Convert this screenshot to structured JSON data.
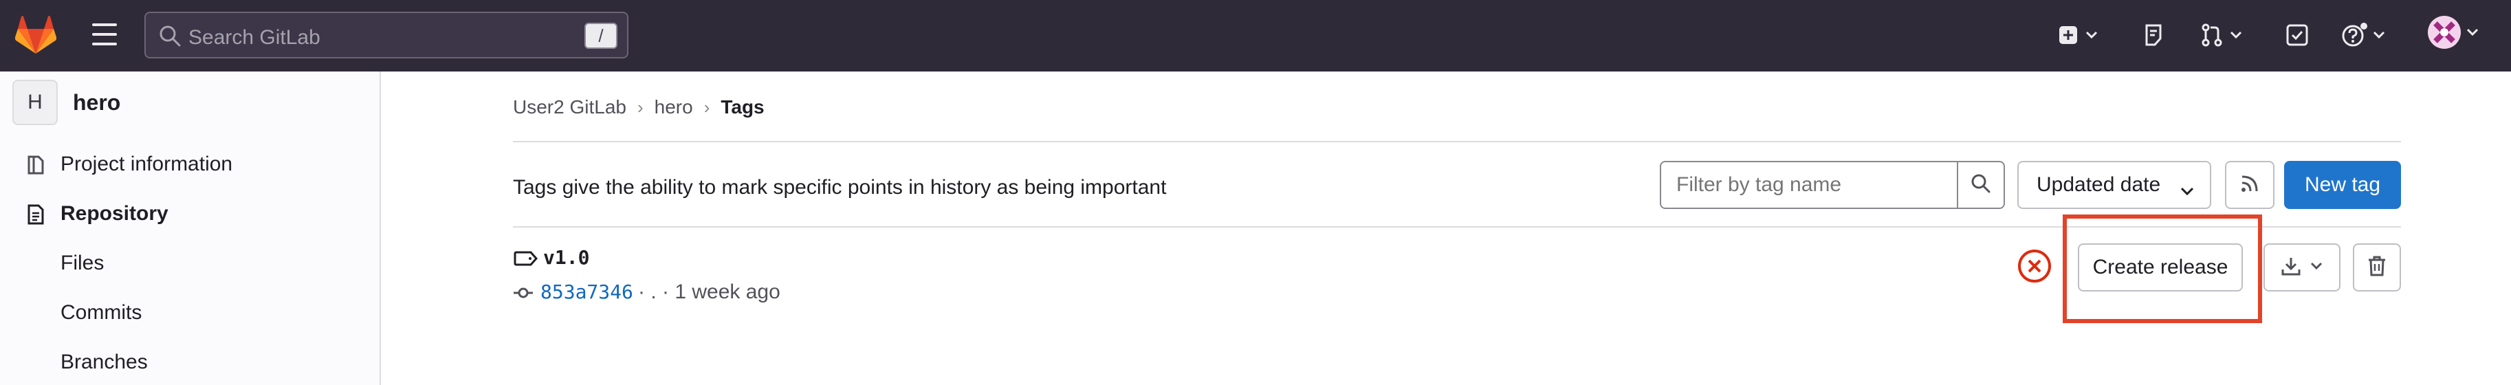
{
  "topbar": {
    "search_placeholder": "Search GitLab",
    "search_shortcut": "/",
    "icons": [
      "gitlab-logo-icon",
      "hamburger-menu-icon",
      "search-icon",
      "create-new-icon",
      "issues-icon",
      "merge-requests-icon",
      "todos-icon",
      "help-icon",
      "user-avatar"
    ]
  },
  "sidebar": {
    "project_avatar_letter": "H",
    "project_name": "hero",
    "items": [
      {
        "label": "Project information",
        "icon": "project-info-icon"
      },
      {
        "label": "Repository",
        "icon": "repository-icon"
      },
      {
        "label": "Files"
      },
      {
        "label": "Commits"
      },
      {
        "label": "Branches"
      }
    ]
  },
  "breadcrumb": {
    "items": [
      "User2 GitLab",
      "hero"
    ],
    "current": "Tags",
    "separator": "›"
  },
  "main": {
    "description": "Tags give the ability to mark specific points in history as being important",
    "filter_placeholder": "Filter by tag name",
    "sort_label": "Updated date",
    "new_tag_label": "New tag"
  },
  "tags": [
    {
      "name": "v1.0",
      "commit_sha": "853a7346",
      "commit_meta": "· . · 1 week ago",
      "pipeline_status": "failed",
      "create_release_label": "Create release"
    }
  ],
  "colors": {
    "topbar_bg": "#2f2a38",
    "primary": "#1f75cb",
    "highlight": "#e24329",
    "status_failed": "#dd2b0e",
    "link": "#1068bf"
  }
}
